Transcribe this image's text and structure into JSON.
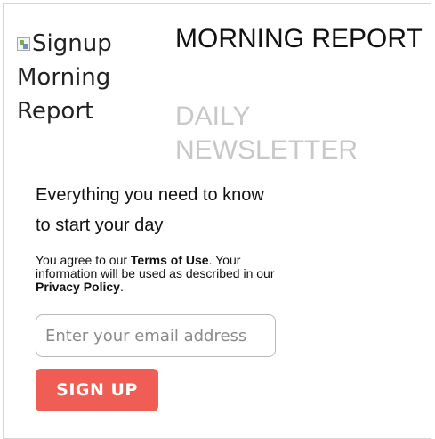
{
  "logo": {
    "alt_text": "Signup Morning Report",
    "icon": "broken-image-icon"
  },
  "header": {
    "title": "MORNING REPORT",
    "subtitle": "DAILY NEWSLETTER"
  },
  "body": {
    "tagline": "Everything you need to know to start your day",
    "terms_prefix": "You agree to our ",
    "terms_link": "Terms of Use",
    "terms_middle": ". Your information will be used as described in our ",
    "privacy_link": "Privacy Policy",
    "terms_suffix": "."
  },
  "form": {
    "email_placeholder": "Enter your email address",
    "submit_label": "SIGN UP",
    "submit_color": "#ef5d54"
  }
}
